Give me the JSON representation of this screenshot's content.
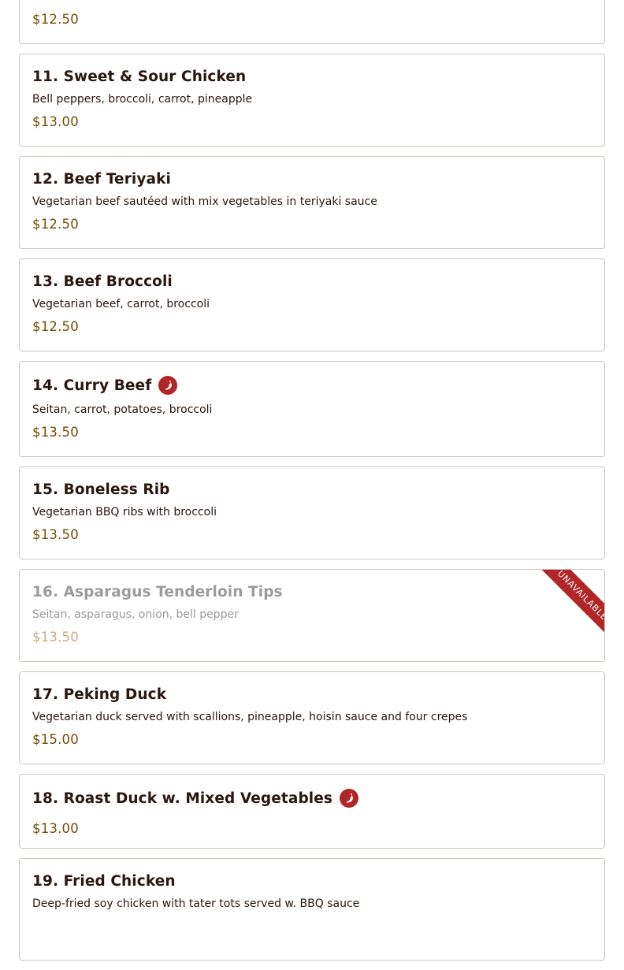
{
  "menu": {
    "items": [
      {
        "title": "",
        "description": "",
        "price": "$12.50",
        "spicy": false,
        "available": true
      },
      {
        "title": "11. Sweet & Sour Chicken",
        "description": "Bell peppers, broccoli, carrot, pineapple",
        "price": "$13.00",
        "spicy": false,
        "available": true
      },
      {
        "title": "12. Beef Teriyaki",
        "description": "Vegetarian beef sautéed with mix vegetables in teriyaki sauce",
        "price": "$12.50",
        "spicy": false,
        "available": true
      },
      {
        "title": "13. Beef Broccoli",
        "description": "Vegetarian beef, carrot, broccoli",
        "price": "$12.50",
        "spicy": false,
        "available": true
      },
      {
        "title": "14. Curry Beef",
        "description": "Seitan, carrot, potatoes, broccoli",
        "price": "$13.50",
        "spicy": true,
        "available": true
      },
      {
        "title": "15. Boneless Rib",
        "description": "Vegetarian BBQ ribs with broccoli",
        "price": "$13.50",
        "spicy": false,
        "available": true
      },
      {
        "title": "16. Asparagus Tenderloin Tips",
        "description": "Seitan, asparagus, onion, bell pepper",
        "price": "$13.50",
        "spicy": false,
        "available": false,
        "badge": "Unavailable"
      },
      {
        "title": "17. Peking Duck",
        "description": "Vegetarian duck served with scallions, pineapple, hoisin sauce and four crepes",
        "price": "$15.00",
        "spicy": false,
        "available": true
      },
      {
        "title": "18. Roast Duck w. Mixed Vegetables",
        "description": "",
        "price": "$13.00",
        "spicy": true,
        "available": true
      },
      {
        "title": "19. Fried Chicken",
        "description": "Deep-fried soy chicken with tater tots served w. BBQ sauce",
        "price": "",
        "spicy": false,
        "available": true
      }
    ]
  },
  "colors": {
    "title": "#2a160f",
    "price": "#7a4a00",
    "accent_red": "#b12626",
    "border": "#cfc6bf",
    "unavailable_text": "#9d9a98",
    "unavailable_price": "#cfa97e"
  },
  "icons": {
    "spicy": "chili-pepper-icon"
  }
}
